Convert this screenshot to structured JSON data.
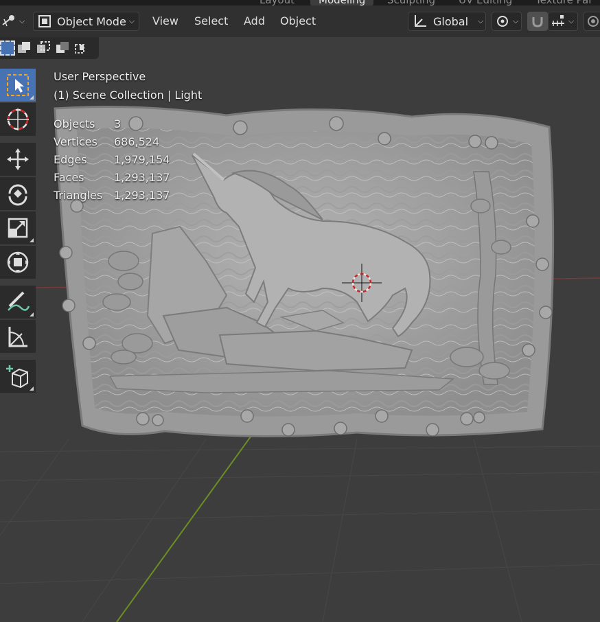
{
  "workspace_tabs": [
    {
      "label": "Layout",
      "active": false
    },
    {
      "label": "Modeling",
      "active": true
    },
    {
      "label": "Sculpting",
      "active": false
    },
    {
      "label": "UV Editing",
      "active": false
    },
    {
      "label": "Texture Pai",
      "active": false
    }
  ],
  "header": {
    "mode_label": "Object Mode",
    "menus": [
      "View",
      "Select",
      "Add",
      "Object"
    ],
    "orientation_label": "Global"
  },
  "overlay": {
    "view_name": "User Perspective",
    "collection_line": "(1) Scene Collection | Light"
  },
  "stats": [
    {
      "label": "Objects",
      "value": "3"
    },
    {
      "label": "Vertices",
      "value": "686,524"
    },
    {
      "label": "Edges",
      "value": "1,979,154"
    },
    {
      "label": "Faces",
      "value": "1,293,137"
    },
    {
      "label": "Triangles",
      "value": "1,293,137"
    }
  ],
  "colors": {
    "viewport_bg": "#3d3d3d",
    "active_tool": "#4772b3",
    "y_axis": "#6b8e23",
    "x_axis": "#9a3b3b"
  }
}
